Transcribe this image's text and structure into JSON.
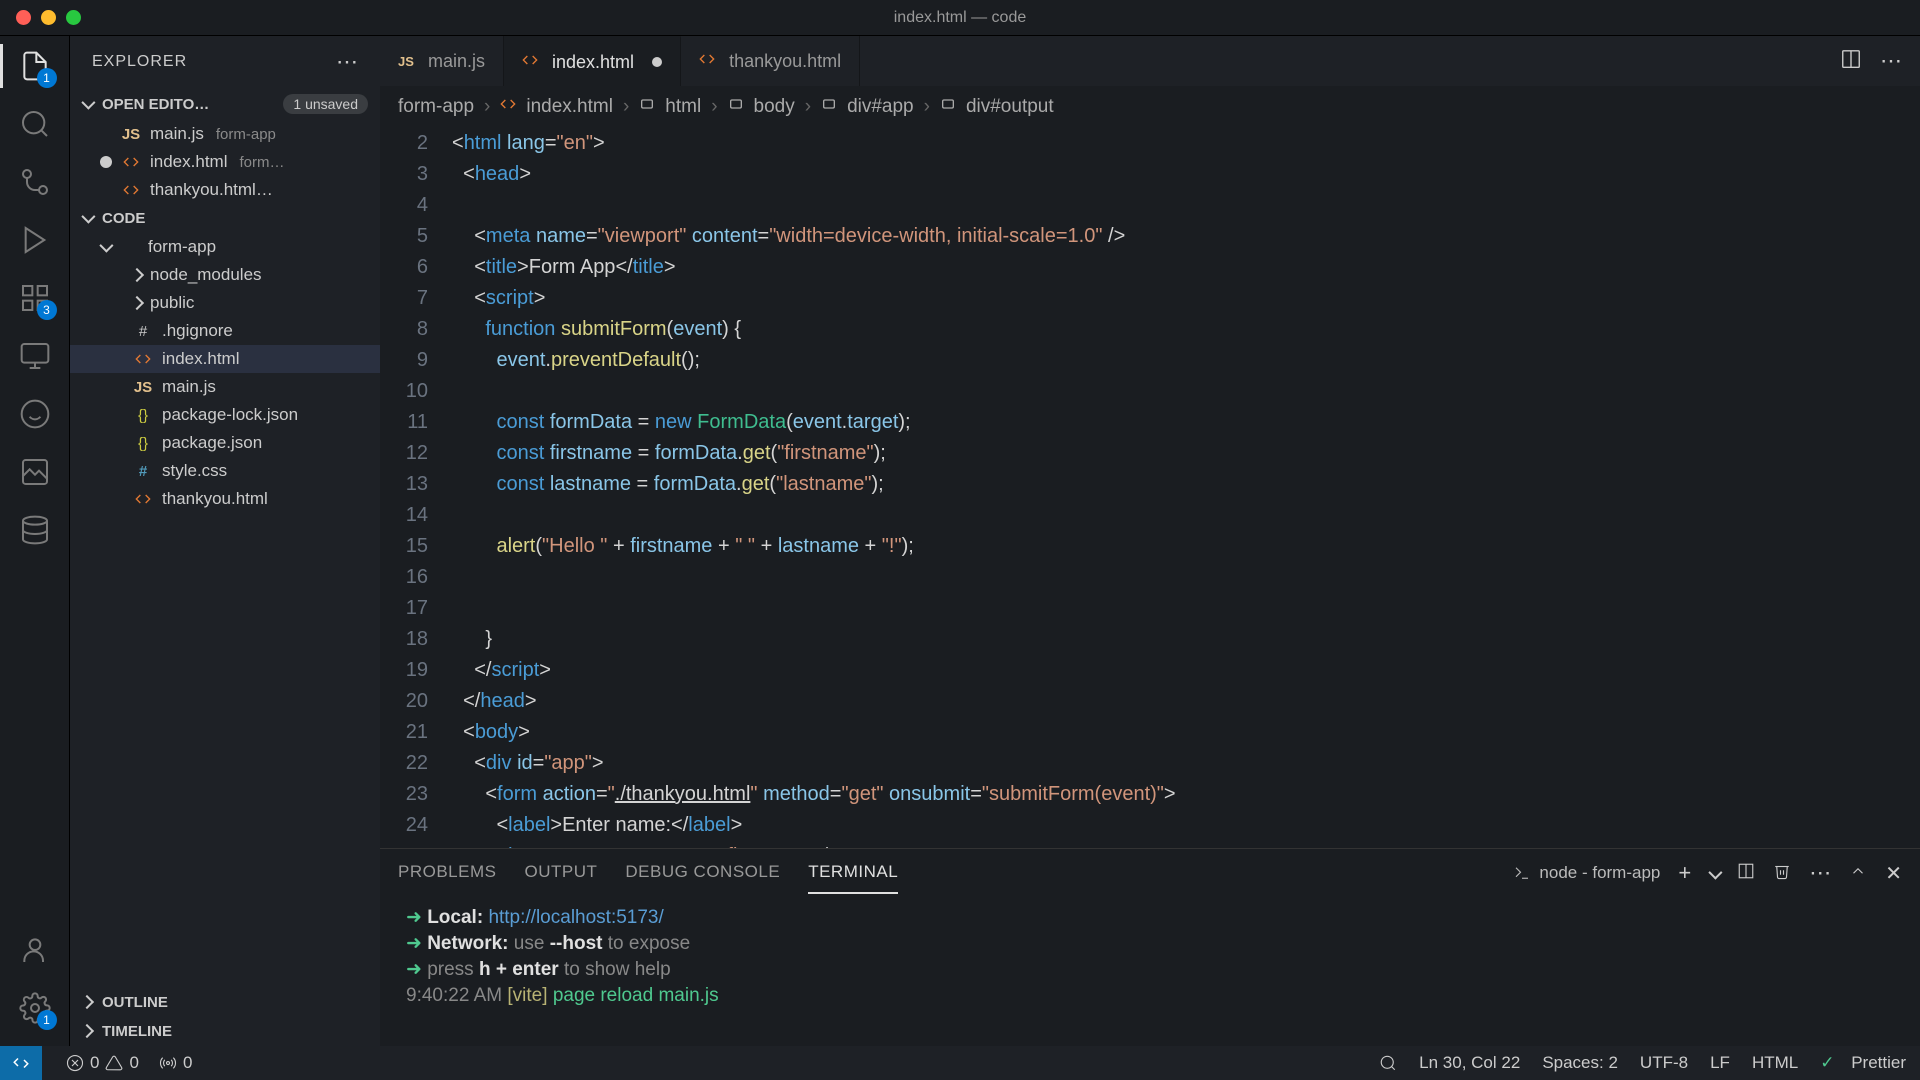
{
  "titlebar": {
    "title": "index.html — code"
  },
  "activitybar": {
    "explorer_badge": "1",
    "scm_badge": "3",
    "account_badge": "1"
  },
  "sidebar": {
    "title": "EXPLORER",
    "open_editors_label": "OPEN EDITO…",
    "unsaved_badge": "1 unsaved",
    "code_label": "CODE",
    "outline_label": "OUTLINE",
    "timeline_label": "TIMELINE",
    "open_editors": [
      {
        "name": "main.js",
        "dir": "form-app",
        "type": "js",
        "dirty": false
      },
      {
        "name": "index.html",
        "dir": "form…",
        "type": "html",
        "dirty": true
      },
      {
        "name": "thankyou.html…",
        "dir": "",
        "type": "html",
        "dirty": false
      }
    ],
    "root": "form-app",
    "tree": [
      {
        "name": "node_modules",
        "type": "folder",
        "indent": 3
      },
      {
        "name": "public",
        "type": "folder",
        "indent": 3
      },
      {
        "name": ".hgignore",
        "type": "file",
        "icon": "hash",
        "indent": 3
      },
      {
        "name": "index.html",
        "type": "file",
        "icon": "html",
        "indent": 3,
        "selected": true
      },
      {
        "name": "main.js",
        "type": "file",
        "icon": "js",
        "indent": 3
      },
      {
        "name": "package-lock.json",
        "type": "file",
        "icon": "json",
        "indent": 3
      },
      {
        "name": "package.json",
        "type": "file",
        "icon": "json",
        "indent": 3
      },
      {
        "name": "style.css",
        "type": "file",
        "icon": "css",
        "indent": 3
      },
      {
        "name": "thankyou.html",
        "type": "file",
        "icon": "html",
        "indent": 3
      }
    ]
  },
  "tabs": [
    {
      "name": "main.js",
      "type": "js",
      "active": false,
      "dirty": false
    },
    {
      "name": "index.html",
      "type": "html",
      "active": true,
      "dirty": true
    },
    {
      "name": "thankyou.html",
      "type": "html",
      "active": false,
      "dirty": false
    }
  ],
  "breadcrumb": [
    "form-app",
    "index.html",
    "html",
    "body",
    "div#app",
    "div#output"
  ],
  "code_first_line": 2,
  "panel": {
    "tabs": [
      "PROBLEMS",
      "OUTPUT",
      "DEBUG CONSOLE",
      "TERMINAL"
    ],
    "active_tab": "TERMINAL",
    "term_label": "node - form-app",
    "local_label": "Local:",
    "local_url": "http://localhost:5173/",
    "network_label": "Network:",
    "network_text1": "use",
    "network_text2": "--host",
    "network_text3": "to expose",
    "help_text1": "press",
    "help_text2": "h + enter",
    "help_text3": "to show help",
    "log_time": "9:40:22 AM",
    "log_vite": "[vite]",
    "log_msg": "page reload main.js"
  },
  "statusbar": {
    "errors": "0",
    "warnings": "0",
    "ports": "0",
    "cursor": "Ln 30, Col 22",
    "spaces": "Spaces: 2",
    "encoding": "UTF-8",
    "eol": "LF",
    "lang": "HTML",
    "formatter": "Prettier"
  }
}
